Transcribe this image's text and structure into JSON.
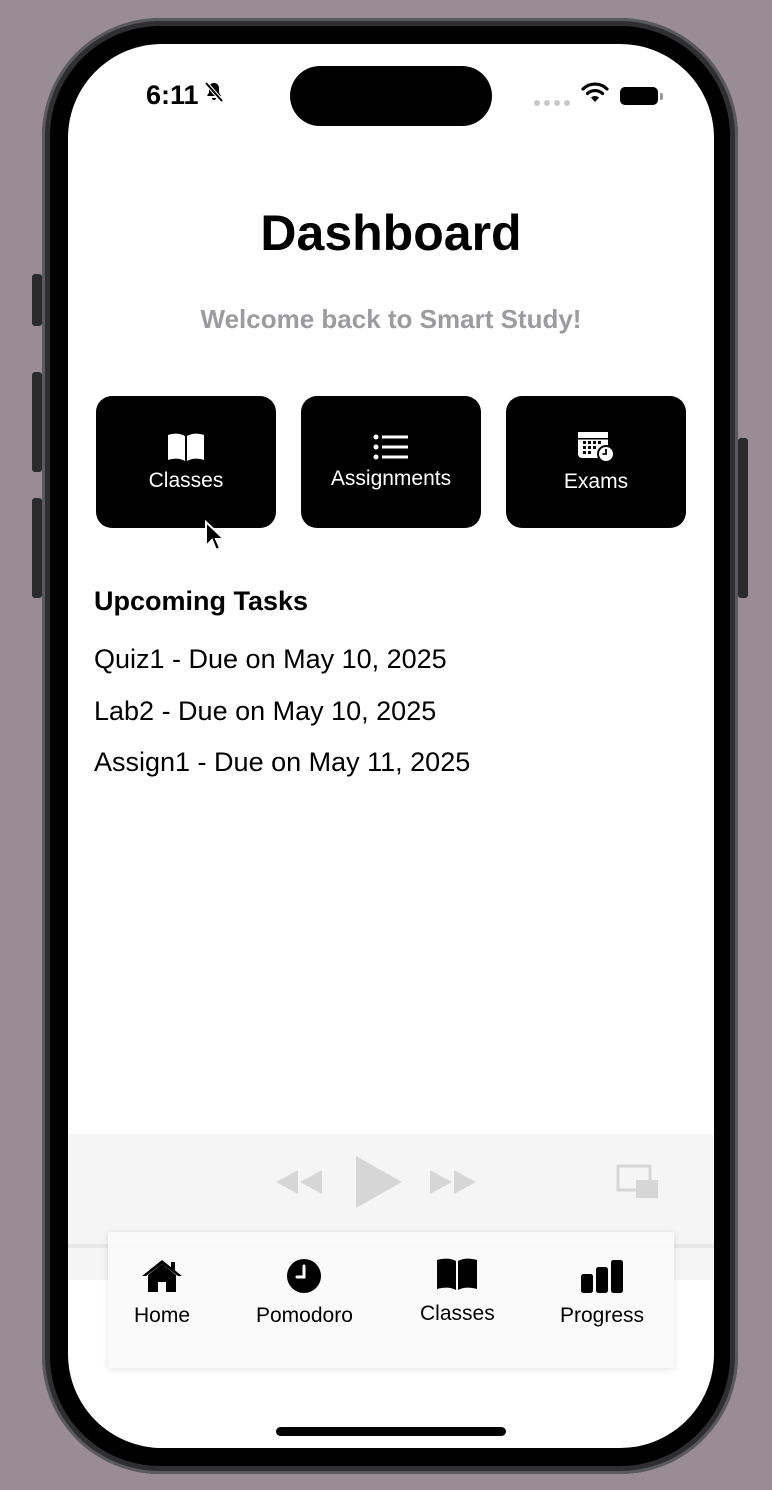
{
  "status_bar": {
    "time": "6:11"
  },
  "header": {
    "title": "Dashboard",
    "subtitle": "Welcome back to Smart Study!"
  },
  "quick_actions": [
    {
      "label": "Classes",
      "icon": "book-icon"
    },
    {
      "label": "Assignments",
      "icon": "list-icon"
    },
    {
      "label": "Exams",
      "icon": "calendar-clock-icon"
    }
  ],
  "upcoming": {
    "title": "Upcoming Tasks",
    "tasks": [
      "Quiz1 - Due on May 10, 2025",
      "Lab2 - Due on May 10, 2025",
      "Assign1 - Due on May 11, 2025"
    ]
  },
  "tabbar": {
    "items": [
      {
        "label": "Home",
        "icon": "house-icon"
      },
      {
        "label": "Pomodoro",
        "icon": "clock-icon"
      },
      {
        "label": "Classes",
        "icon": "book-icon"
      },
      {
        "label": "Progress",
        "icon": "bar-chart-icon"
      }
    ]
  },
  "colors": {
    "background": "#9a8c94",
    "card": "#000000",
    "subtitle": "#9b9ba0"
  }
}
